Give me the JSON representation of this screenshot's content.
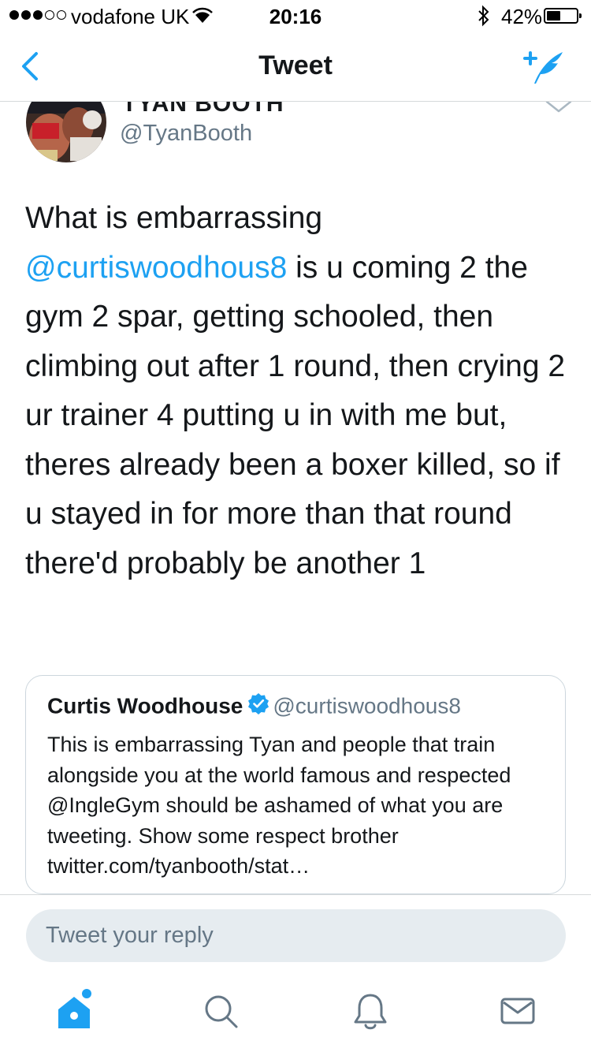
{
  "status_bar": {
    "carrier": "vodafone UK",
    "time": "20:16",
    "battery_percent": "42%",
    "battery_level": 0.42,
    "signal_bars_filled": 3,
    "signal_bars_total": 5
  },
  "nav": {
    "title": "Tweet"
  },
  "tweet": {
    "display_name": "TYAN BOOTH",
    "username": "@TyanBooth",
    "text_before_mention": "What is embarrassing ",
    "mention": "@curtiswoodhous8",
    "text_after_mention": " is u coming 2 the gym 2 spar, getting schooled, then climbing out after 1 round, then crying 2 ur trainer 4 putting u in with me but, theres already been a boxer killed, so if u stayed in for more than that round there'd probably be another 1"
  },
  "quoted_tweet": {
    "display_name": "Curtis Woodhouse",
    "username": "@curtiswoodhous8",
    "verified": true,
    "text": "This is embarrassing Tyan and people that train alongside you at the world famous and respected @IngleGym should be ashamed of what you are tweeting. Show some respect brother twitter.com/tyanbooth/stat…"
  },
  "reply": {
    "placeholder": "Tweet your reply"
  },
  "tab_bar": {
    "tabs": [
      {
        "name": "home",
        "icon": "home-icon",
        "active": true,
        "has_notification_dot": true
      },
      {
        "name": "search",
        "icon": "search-icon",
        "active": false
      },
      {
        "name": "notifications",
        "icon": "bell-icon",
        "active": false
      },
      {
        "name": "messages",
        "icon": "envelope-icon",
        "active": false
      }
    ]
  },
  "colors": {
    "accent": "#1da1f2",
    "text_primary": "#14171a",
    "text_secondary": "#657786",
    "input_background": "#e6ecf0",
    "divider": "#d6d9db"
  }
}
